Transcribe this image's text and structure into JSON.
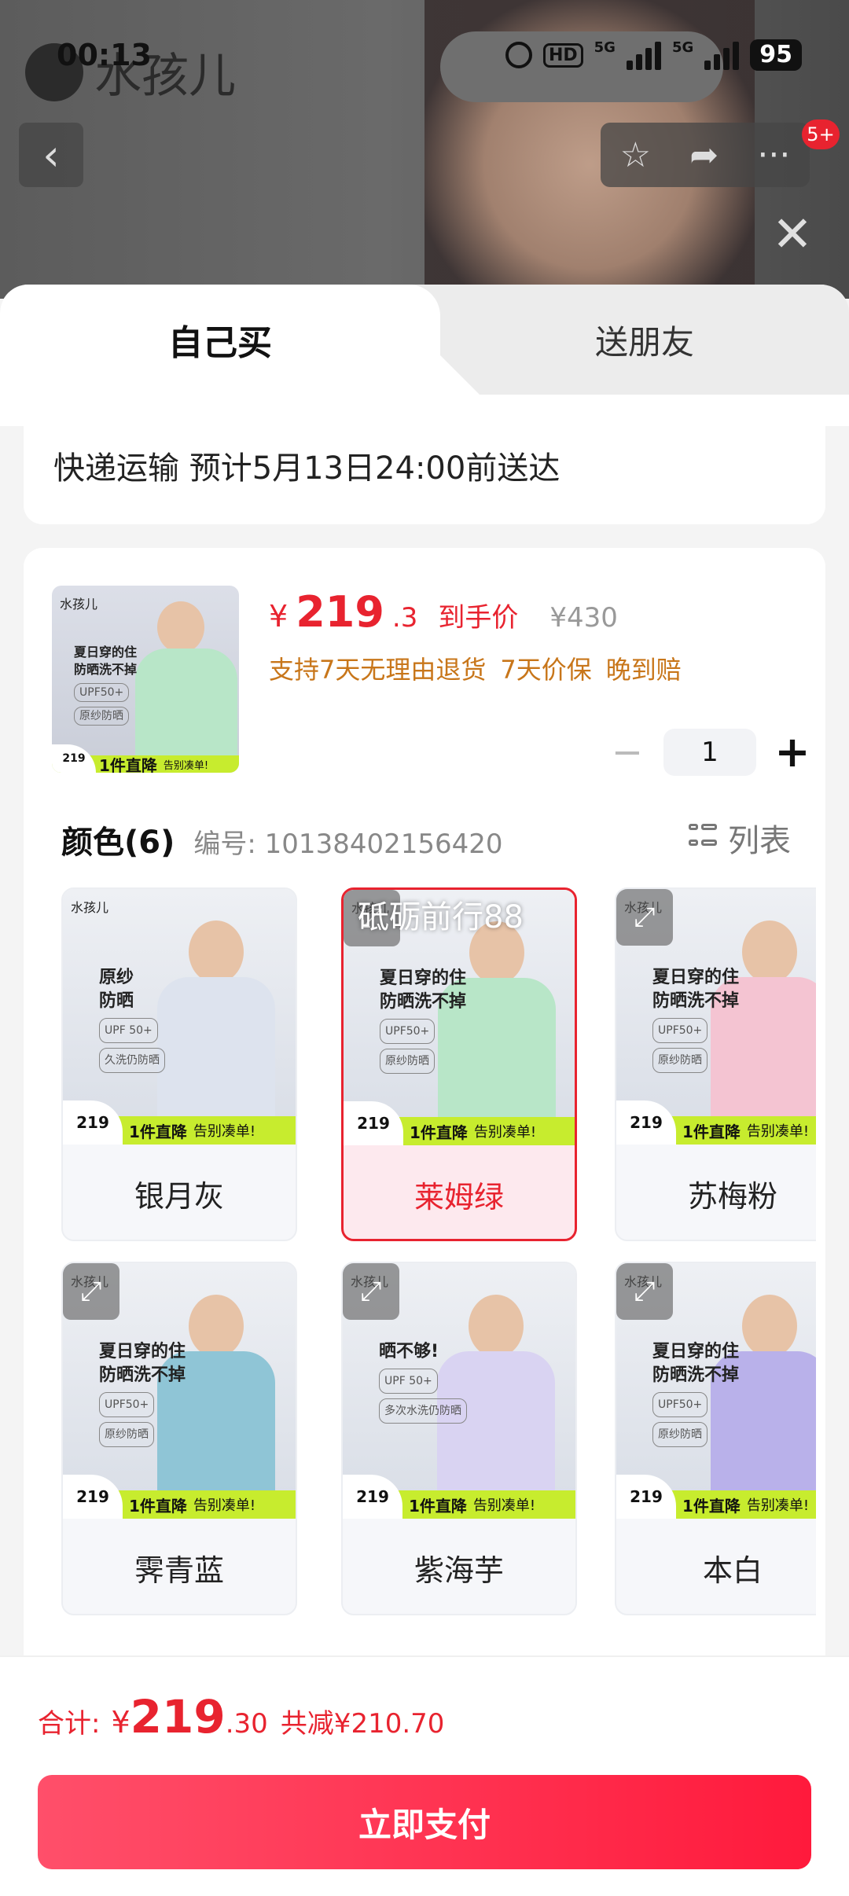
{
  "status_bar": {
    "time": "00:13",
    "network_1": "5G",
    "network_2": "5G",
    "hd": "HD",
    "battery": "95"
  },
  "brand": {
    "logo_text": "水孩儿"
  },
  "nav": {
    "notification_badge": "5+"
  },
  "tabs": {
    "self_buy": "自己买",
    "gift": "送朋友"
  },
  "shipping": {
    "text": "快递运输 预计5月13日24:00前送达"
  },
  "product": {
    "price_symbol": "¥",
    "price_int": "219",
    "price_dec": ".3",
    "price_label": "到手价",
    "original_price": "¥430",
    "perks": [
      "支持7天无理由退货",
      "7天价保",
      "晚到赔"
    ],
    "quantity": "1",
    "thumb": {
      "line1": "夏日穿的住",
      "line2": "防晒洗不掉",
      "tag1": "UPF50+",
      "tag2": "原纱防晒",
      "price": "219",
      "strip": "1件直降",
      "strip2": "告别凑单!"
    }
  },
  "colors": {
    "title": "颜色(6)",
    "code": "编号: 10138402156420",
    "view_toggle": "列表",
    "overlay_promo": "砥砺前行88",
    "items": [
      {
        "name": "银月灰",
        "selected": false,
        "color": "#dde3ee",
        "headline": "原纱\n防晒",
        "tag": "UPF 50+",
        "sub": "久洗仍防晒"
      },
      {
        "name": "莱姆绿",
        "selected": true,
        "color": "#b8e6c8",
        "headline": "夏日穿的住\n防晒洗不掉",
        "tag": "UPF50+",
        "sub": "原纱防晒"
      },
      {
        "name": "苏梅粉",
        "selected": false,
        "color": "#f4c4d2",
        "headline": "夏日穿的住\n防晒洗不掉",
        "tag": "UPF50+",
        "sub": "原纱防晒"
      },
      {
        "name": "霁青蓝",
        "selected": false,
        "color": "#8fc5d6",
        "headline": "夏日穿的住\n防晒洗不掉",
        "tag": "UPF50+",
        "sub": "原纱防晒"
      },
      {
        "name": "紫海芋",
        "selected": false,
        "color": "#d9d3f2",
        "headline": "晒不够!",
        "tag": "UPF 50+",
        "sub": "多次水洗仍防晒"
      },
      {
        "name": "本白",
        "selected": false,
        "color": "#b9b1ea",
        "headline": "夏日穿的住\n防晒洗不掉",
        "tag": "UPF50+",
        "sub": "原纱防晒"
      }
    ],
    "tile_price": "219",
    "tile_strip": "1件直降",
    "tile_strip2": "告别凑单!"
  },
  "footer": {
    "total_label": "合计:",
    "total_symbol": "¥",
    "total_int": "219",
    "total_dec": ".30",
    "savings": "共减¥210.70",
    "pay_button": "立即支付"
  },
  "theme": {
    "accent": "#e8232f",
    "perk_color": "#c8761a"
  }
}
